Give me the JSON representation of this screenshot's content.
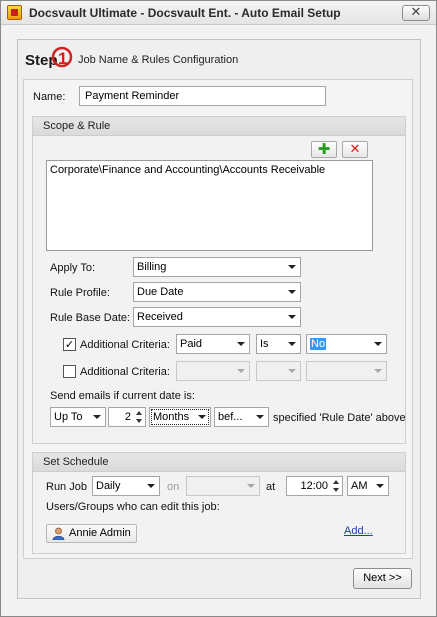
{
  "window": {
    "title": "Docsvault Ultimate - Docsvault Ent. - Auto Email Setup",
    "close_glyph": "✕"
  },
  "step": {
    "word": "Step",
    "number": "1",
    "title": "Job Name & Rules Configuration"
  },
  "name_field": {
    "label": "Name:",
    "value": "Payment Reminder"
  },
  "scope": {
    "header": "Scope & Rule",
    "add_glyph": "✚",
    "remove_glyph": "✕",
    "folders": [
      "Corporate\\Finance and Accounting\\Accounts Receivable"
    ]
  },
  "rule": {
    "apply_to_label": "Apply To:",
    "apply_to_value": "Billing",
    "profile_label": "Rule Profile:",
    "profile_value": "Due Date",
    "base_date_label": "Rule Base Date:",
    "base_date_value": "Received",
    "criteria1": {
      "checked": true,
      "check_glyph": "✓",
      "label": "Additional Criteria:",
      "field": "Paid",
      "operator": "Is",
      "value": "No"
    },
    "criteria2": {
      "checked": false,
      "label": "Additional Criteria:",
      "field": "",
      "operator": "",
      "value": ""
    },
    "send_label": "Send emails if current date is:",
    "range_value": "Up To",
    "count_value": "2",
    "unit_value": "Months",
    "direction_value": "bef...",
    "suffix": "specified 'Rule Date' above"
  },
  "schedule": {
    "header": "Set Schedule",
    "run_job_label": "Run Job",
    "frequency_value": "Daily",
    "on_label": "on",
    "on_value": "",
    "at_label": "at",
    "time_value": "12:00",
    "ampm_value": "AM",
    "editors_label": "Users/Groups who can edit this job:",
    "users": [
      {
        "name": "Annie Admin"
      }
    ],
    "add_link": "Add..."
  },
  "footer": {
    "next_label": "Next >>"
  },
  "colors": {
    "accent_green": "#2a9a20",
    "accent_red": "#d22020",
    "selection_blue": "#3399ff",
    "link_blue": "#1a3fa6"
  }
}
